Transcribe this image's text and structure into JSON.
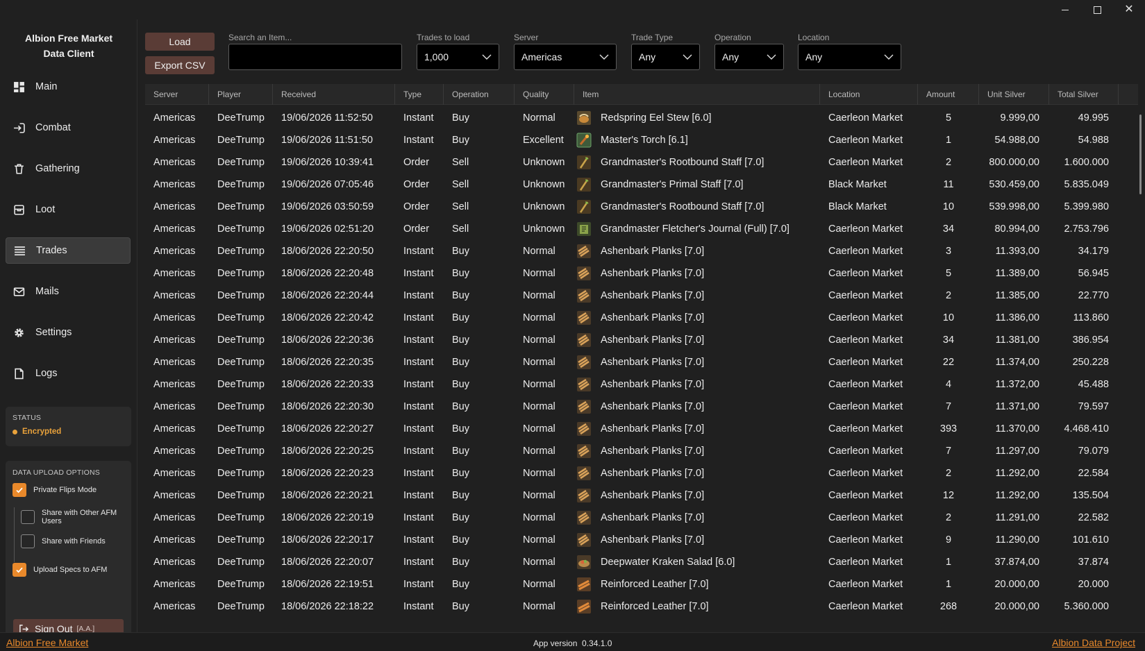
{
  "window": {
    "controls": [
      "minimize",
      "maximize",
      "close"
    ]
  },
  "sidebar": {
    "title_line1": "Albion Free Market",
    "title_line2": "Data Client",
    "items": [
      {
        "label": "Main",
        "icon": "dashboard-icon"
      },
      {
        "label": "Combat",
        "icon": "combat-icon"
      },
      {
        "label": "Gathering",
        "icon": "gathering-icon"
      },
      {
        "label": "Loot",
        "icon": "loot-icon"
      },
      {
        "label": "Trades",
        "icon": "trades-icon",
        "active": true
      },
      {
        "label": "Mails",
        "icon": "mail-icon"
      },
      {
        "label": "Settings",
        "icon": "gear-icon"
      },
      {
        "label": "Logs",
        "icon": "logs-icon"
      }
    ],
    "status": {
      "title": "STATUS",
      "value": "Encrypted",
      "color": "#e9a23b"
    },
    "upload": {
      "title": "DATA UPLOAD OPTIONS",
      "private_flips": {
        "label": "Private Flips Mode",
        "checked": true
      },
      "share_afm": {
        "label": "Share with Other AFM Users",
        "checked": false
      },
      "share_friends": {
        "label": "Share with Friends",
        "checked": false
      },
      "upload_specs": {
        "label": "Upload Specs to AFM",
        "checked": true
      }
    },
    "signout": {
      "label": "Sign Out",
      "tag": "[A.A.]"
    }
  },
  "toolbar": {
    "load_label": "Load",
    "export_label": "Export CSV",
    "search": {
      "label": "Search an Item...",
      "value": "",
      "placeholder": ""
    },
    "trades_to_load": {
      "label": "Trades to load",
      "value": "1,000"
    },
    "server": {
      "label": "Server",
      "value": "Americas"
    },
    "trade_type": {
      "label": "Trade Type",
      "value": "Any"
    },
    "operation": {
      "label": "Operation",
      "value": "Any"
    },
    "location": {
      "label": "Location",
      "value": "Any"
    }
  },
  "table": {
    "columns": [
      "Server",
      "Player",
      "Received",
      "Type",
      "Operation",
      "Quality",
      "Item",
      "Location",
      "Amount",
      "Unit Silver",
      "Total Silver"
    ],
    "rows": [
      [
        "Americas",
        "DeeTrump",
        "19/06/2026 11:52:50",
        "Instant",
        "Buy",
        "Normal",
        "Redspring Eel Stew [6.0]",
        "Caerleon Market",
        "5",
        "9.999,00",
        "49.995",
        "food"
      ],
      [
        "Americas",
        "DeeTrump",
        "19/06/2026 11:51:50",
        "Instant",
        "Buy",
        "Excellent",
        "Master's Torch [6.1]",
        "Caerleon Market",
        "1",
        "54.988,00",
        "54.988",
        "torch"
      ],
      [
        "Americas",
        "DeeTrump",
        "19/06/2026 10:39:41",
        "Order",
        "Sell",
        "Unknown",
        "Grandmaster's Rootbound Staff [7.0]",
        "Caerleon Market",
        "2",
        "800.000,00",
        "1.600.000",
        "staff"
      ],
      [
        "Americas",
        "DeeTrump",
        "19/06/2026 07:05:46",
        "Order",
        "Sell",
        "Unknown",
        "Grandmaster's Primal Staff [7.0]",
        "Black Market",
        "11",
        "530.459,00",
        "5.835.049",
        "staff"
      ],
      [
        "Americas",
        "DeeTrump",
        "19/06/2026 03:50:59",
        "Order",
        "Sell",
        "Unknown",
        "Grandmaster's Rootbound Staff [7.0]",
        "Black Market",
        "10",
        "539.998,00",
        "5.399.980",
        "staff"
      ],
      [
        "Americas",
        "DeeTrump",
        "19/06/2026 02:51:20",
        "Order",
        "Sell",
        "Unknown",
        "Grandmaster Fletcher's Journal (Full) [7.0]",
        "Caerleon Market",
        "34",
        "80.994,00",
        "2.753.796",
        "journal"
      ],
      [
        "Americas",
        "DeeTrump",
        "18/06/2026 22:20:50",
        "Instant",
        "Buy",
        "Normal",
        "Ashenbark Planks [7.0]",
        "Caerleon Market",
        "3",
        "11.393,00",
        "34.179",
        "planks"
      ],
      [
        "Americas",
        "DeeTrump",
        "18/06/2026 22:20:48",
        "Instant",
        "Buy",
        "Normal",
        "Ashenbark Planks [7.0]",
        "Caerleon Market",
        "5",
        "11.389,00",
        "56.945",
        "planks"
      ],
      [
        "Americas",
        "DeeTrump",
        "18/06/2026 22:20:44",
        "Instant",
        "Buy",
        "Normal",
        "Ashenbark Planks [7.0]",
        "Caerleon Market",
        "2",
        "11.385,00",
        "22.770",
        "planks"
      ],
      [
        "Americas",
        "DeeTrump",
        "18/06/2026 22:20:42",
        "Instant",
        "Buy",
        "Normal",
        "Ashenbark Planks [7.0]",
        "Caerleon Market",
        "10",
        "11.386,00",
        "113.860",
        "planks"
      ],
      [
        "Americas",
        "DeeTrump",
        "18/06/2026 22:20:36",
        "Instant",
        "Buy",
        "Normal",
        "Ashenbark Planks [7.0]",
        "Caerleon Market",
        "34",
        "11.381,00",
        "386.954",
        "planks"
      ],
      [
        "Americas",
        "DeeTrump",
        "18/06/2026 22:20:35",
        "Instant",
        "Buy",
        "Normal",
        "Ashenbark Planks [7.0]",
        "Caerleon Market",
        "22",
        "11.374,00",
        "250.228",
        "planks"
      ],
      [
        "Americas",
        "DeeTrump",
        "18/06/2026 22:20:33",
        "Instant",
        "Buy",
        "Normal",
        "Ashenbark Planks [7.0]",
        "Caerleon Market",
        "4",
        "11.372,00",
        "45.488",
        "planks"
      ],
      [
        "Americas",
        "DeeTrump",
        "18/06/2026 22:20:30",
        "Instant",
        "Buy",
        "Normal",
        "Ashenbark Planks [7.0]",
        "Caerleon Market",
        "7",
        "11.371,00",
        "79.597",
        "planks"
      ],
      [
        "Americas",
        "DeeTrump",
        "18/06/2026 22:20:27",
        "Instant",
        "Buy",
        "Normal",
        "Ashenbark Planks [7.0]",
        "Caerleon Market",
        "393",
        "11.370,00",
        "4.468.410",
        "planks"
      ],
      [
        "Americas",
        "DeeTrump",
        "18/06/2026 22:20:25",
        "Instant",
        "Buy",
        "Normal",
        "Ashenbark Planks [7.0]",
        "Caerleon Market",
        "7",
        "11.297,00",
        "79.079",
        "planks"
      ],
      [
        "Americas",
        "DeeTrump",
        "18/06/2026 22:20:23",
        "Instant",
        "Buy",
        "Normal",
        "Ashenbark Planks [7.0]",
        "Caerleon Market",
        "2",
        "11.292,00",
        "22.584",
        "planks"
      ],
      [
        "Americas",
        "DeeTrump",
        "18/06/2026 22:20:21",
        "Instant",
        "Buy",
        "Normal",
        "Ashenbark Planks [7.0]",
        "Caerleon Market",
        "12",
        "11.292,00",
        "135.504",
        "planks"
      ],
      [
        "Americas",
        "DeeTrump",
        "18/06/2026 22:20:19",
        "Instant",
        "Buy",
        "Normal",
        "Ashenbark Planks [7.0]",
        "Caerleon Market",
        "2",
        "11.291,00",
        "22.582",
        "planks"
      ],
      [
        "Americas",
        "DeeTrump",
        "18/06/2026 22:20:17",
        "Instant",
        "Buy",
        "Normal",
        "Ashenbark Planks [7.0]",
        "Caerleon Market",
        "9",
        "11.290,00",
        "101.610",
        "planks"
      ],
      [
        "Americas",
        "DeeTrump",
        "18/06/2026 22:20:07",
        "Instant",
        "Buy",
        "Normal",
        "Deepwater Kraken Salad [6.0]",
        "Caerleon Market",
        "1",
        "37.874,00",
        "37.874",
        "salad"
      ],
      [
        "Americas",
        "DeeTrump",
        "18/06/2026 22:19:51",
        "Instant",
        "Buy",
        "Normal",
        "Reinforced Leather [7.0]",
        "Caerleon Market",
        "1",
        "20.000,00",
        "20.000",
        "leather"
      ],
      [
        "Americas",
        "DeeTrump",
        "18/06/2026 22:18:22",
        "Instant",
        "Buy",
        "Normal",
        "Reinforced Leather [7.0]",
        "Caerleon Market",
        "268",
        "20.000,00",
        "5.360.000",
        "leather"
      ]
    ]
  },
  "footer": {
    "left_link": "Albion Free Market",
    "version_label": "App version",
    "version": "0.34.1.0",
    "right_link": "Albion Data Project"
  },
  "colors": {
    "accent": "#e9892b",
    "button": "#5a3c36",
    "status": "#e9a23b"
  }
}
